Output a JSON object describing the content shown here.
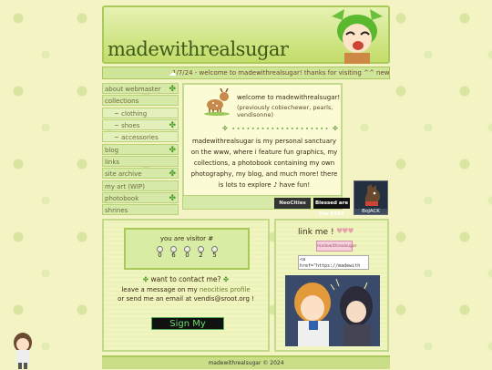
{
  "site": {
    "title": "madewithrealsugar"
  },
  "marquee": {
    "text": "1/7/24 - welcome to madewithrealsugar! thanks for visiting ^^ new"
  },
  "sidebar": {
    "items": [
      {
        "label": "about webmaster",
        "leaf": true,
        "sub": false
      },
      {
        "label": "collections",
        "leaf": false,
        "sub": false
      },
      {
        "label": "~ clothing",
        "leaf": false,
        "sub": true
      },
      {
        "label": "~ shoes",
        "leaf": true,
        "sub": true
      },
      {
        "label": "~ accessories",
        "leaf": false,
        "sub": true
      },
      {
        "label": "blog",
        "leaf": true,
        "sub": false
      },
      {
        "label": "links",
        "leaf": false,
        "sub": false
      },
      {
        "label": "site archive",
        "leaf": true,
        "sub": false
      },
      {
        "label": "my art (WIP)",
        "leaf": false,
        "sub": false
      },
      {
        "label": "photobook",
        "leaf": true,
        "sub": false
      },
      {
        "label": "shrines",
        "leaf": false,
        "sub": false
      }
    ]
  },
  "intro": {
    "title": "welcome to madewithrealsugar!",
    "prev_names": "(previously cobiechewer, pearls, vendisonne)",
    "body": "madewithrealsugar is my personal sanctuary on the www, where i feature fun graphics, my collections, a photobook containing my own photography, my blog, and much more! there is lots to explore ♪ have fun!"
  },
  "badges": {
    "neocities": "NeoCities",
    "blessed": "Blessed are the EYES"
  },
  "bojack": {
    "label": "BoJACK"
  },
  "visitor": {
    "label": "you are visitor #",
    "digits": [
      "0",
      "6",
      "0",
      "2",
      "5"
    ]
  },
  "contact": {
    "title": "want to contact me?",
    "line1_pre": "leave a message on my ",
    "line1_link": "neocities profile",
    "line2": "or send me an email at vendis@sroot.org !",
    "signbutton": "Sign My"
  },
  "linkme": {
    "title": "link me !",
    "banner": "madewithrealsugar",
    "code": "<a href=\"https://madewith"
  },
  "footer": {
    "text": "madewithrealsugar © 2024"
  }
}
